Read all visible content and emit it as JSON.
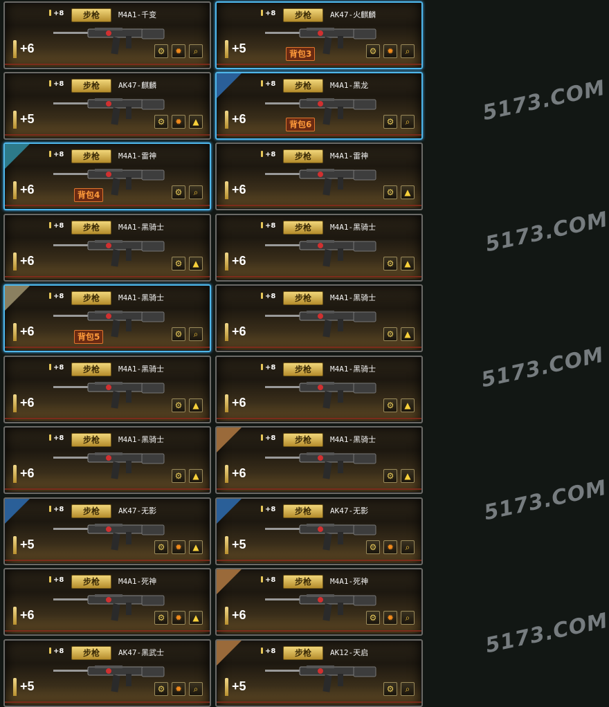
{
  "category_label": "步枪",
  "level_badge": "+8",
  "cards": [
    {
      "name": "M4A1-千变",
      "plus": "+6",
      "bag": "",
      "selected": false,
      "corner": "",
      "buttons": [
        "wrench",
        "gear",
        "magnify"
      ]
    },
    {
      "name": "AK47-火麒麟",
      "plus": "+5",
      "bag": "背包3",
      "selected": true,
      "corner": "",
      "buttons": [
        "wrench",
        "gear",
        "magnify"
      ]
    },
    {
      "name": "AK47-麒麟",
      "plus": "+5",
      "bag": "",
      "selected": false,
      "corner": "",
      "buttons": [
        "wrench",
        "gear",
        "upgrade"
      ]
    },
    {
      "name": "M4A1-黑龙",
      "plus": "+6",
      "bag": "背包6",
      "selected": true,
      "corner": "blue",
      "buttons": [
        "wrench",
        "magnify"
      ]
    },
    {
      "name": "M4A1-雷神",
      "plus": "+6",
      "bag": "背包4",
      "selected": true,
      "corner": "cyan",
      "buttons": [
        "wrench",
        "magnify"
      ]
    },
    {
      "name": "M4A1-雷神",
      "plus": "+6",
      "bag": "",
      "selected": false,
      "corner": "",
      "buttons": [
        "wrench",
        "upgrade"
      ]
    },
    {
      "name": "M4A1-黑骑士",
      "plus": "+6",
      "bag": "",
      "selected": false,
      "corner": "",
      "buttons": [
        "wrench",
        "upgrade"
      ]
    },
    {
      "name": "M4A1-黑骑士",
      "plus": "+6",
      "bag": "",
      "selected": false,
      "corner": "",
      "buttons": [
        "wrench",
        "upgrade"
      ]
    },
    {
      "name": "M4A1-黑骑士",
      "plus": "+6",
      "bag": "背包5",
      "selected": true,
      "corner": "olive",
      "buttons": [
        "wrench",
        "magnify"
      ]
    },
    {
      "name": "M4A1-黑骑士",
      "plus": "+6",
      "bag": "",
      "selected": false,
      "corner": "",
      "buttons": [
        "wrench",
        "upgrade"
      ]
    },
    {
      "name": "M4A1-黑骑士",
      "plus": "+6",
      "bag": "",
      "selected": false,
      "corner": "",
      "buttons": [
        "wrench",
        "upgrade"
      ]
    },
    {
      "name": "M4A1-黑骑士",
      "plus": "+6",
      "bag": "",
      "selected": false,
      "corner": "",
      "buttons": [
        "wrench",
        "upgrade"
      ]
    },
    {
      "name": "M4A1-黑骑士",
      "plus": "+6",
      "bag": "",
      "selected": false,
      "corner": "",
      "buttons": [
        "wrench",
        "upgrade"
      ]
    },
    {
      "name": "M4A1-黑骑士",
      "plus": "+6",
      "bag": "",
      "selected": false,
      "corner": "brown",
      "buttons": [
        "wrench",
        "upgrade"
      ]
    },
    {
      "name": "AK47-无影",
      "plus": "+5",
      "bag": "",
      "selected": false,
      "corner": "blue",
      "buttons": [
        "wrench",
        "gear",
        "upgrade"
      ]
    },
    {
      "name": "AK47-无影",
      "plus": "+5",
      "bag": "",
      "selected": false,
      "corner": "blue",
      "buttons": [
        "wrench",
        "gear",
        "magnify"
      ]
    },
    {
      "name": "M4A1-死神",
      "plus": "+6",
      "bag": "",
      "selected": false,
      "corner": "",
      "buttons": [
        "wrench",
        "gear",
        "upgrade"
      ]
    },
    {
      "name": "M4A1-死神",
      "plus": "+6",
      "bag": "",
      "selected": false,
      "corner": "brown",
      "buttons": [
        "wrench",
        "gear",
        "magnify"
      ]
    },
    {
      "name": "AK47-黑武士",
      "plus": "+5",
      "bag": "",
      "selected": false,
      "corner": "",
      "buttons": [
        "wrench",
        "gear",
        "magnify"
      ]
    },
    {
      "name": "AK12-天启",
      "plus": "+5",
      "bag": "",
      "selected": false,
      "corner": "brown",
      "buttons": [
        "wrench",
        "magnify"
      ]
    }
  ],
  "watermark_text": "5173.COM"
}
